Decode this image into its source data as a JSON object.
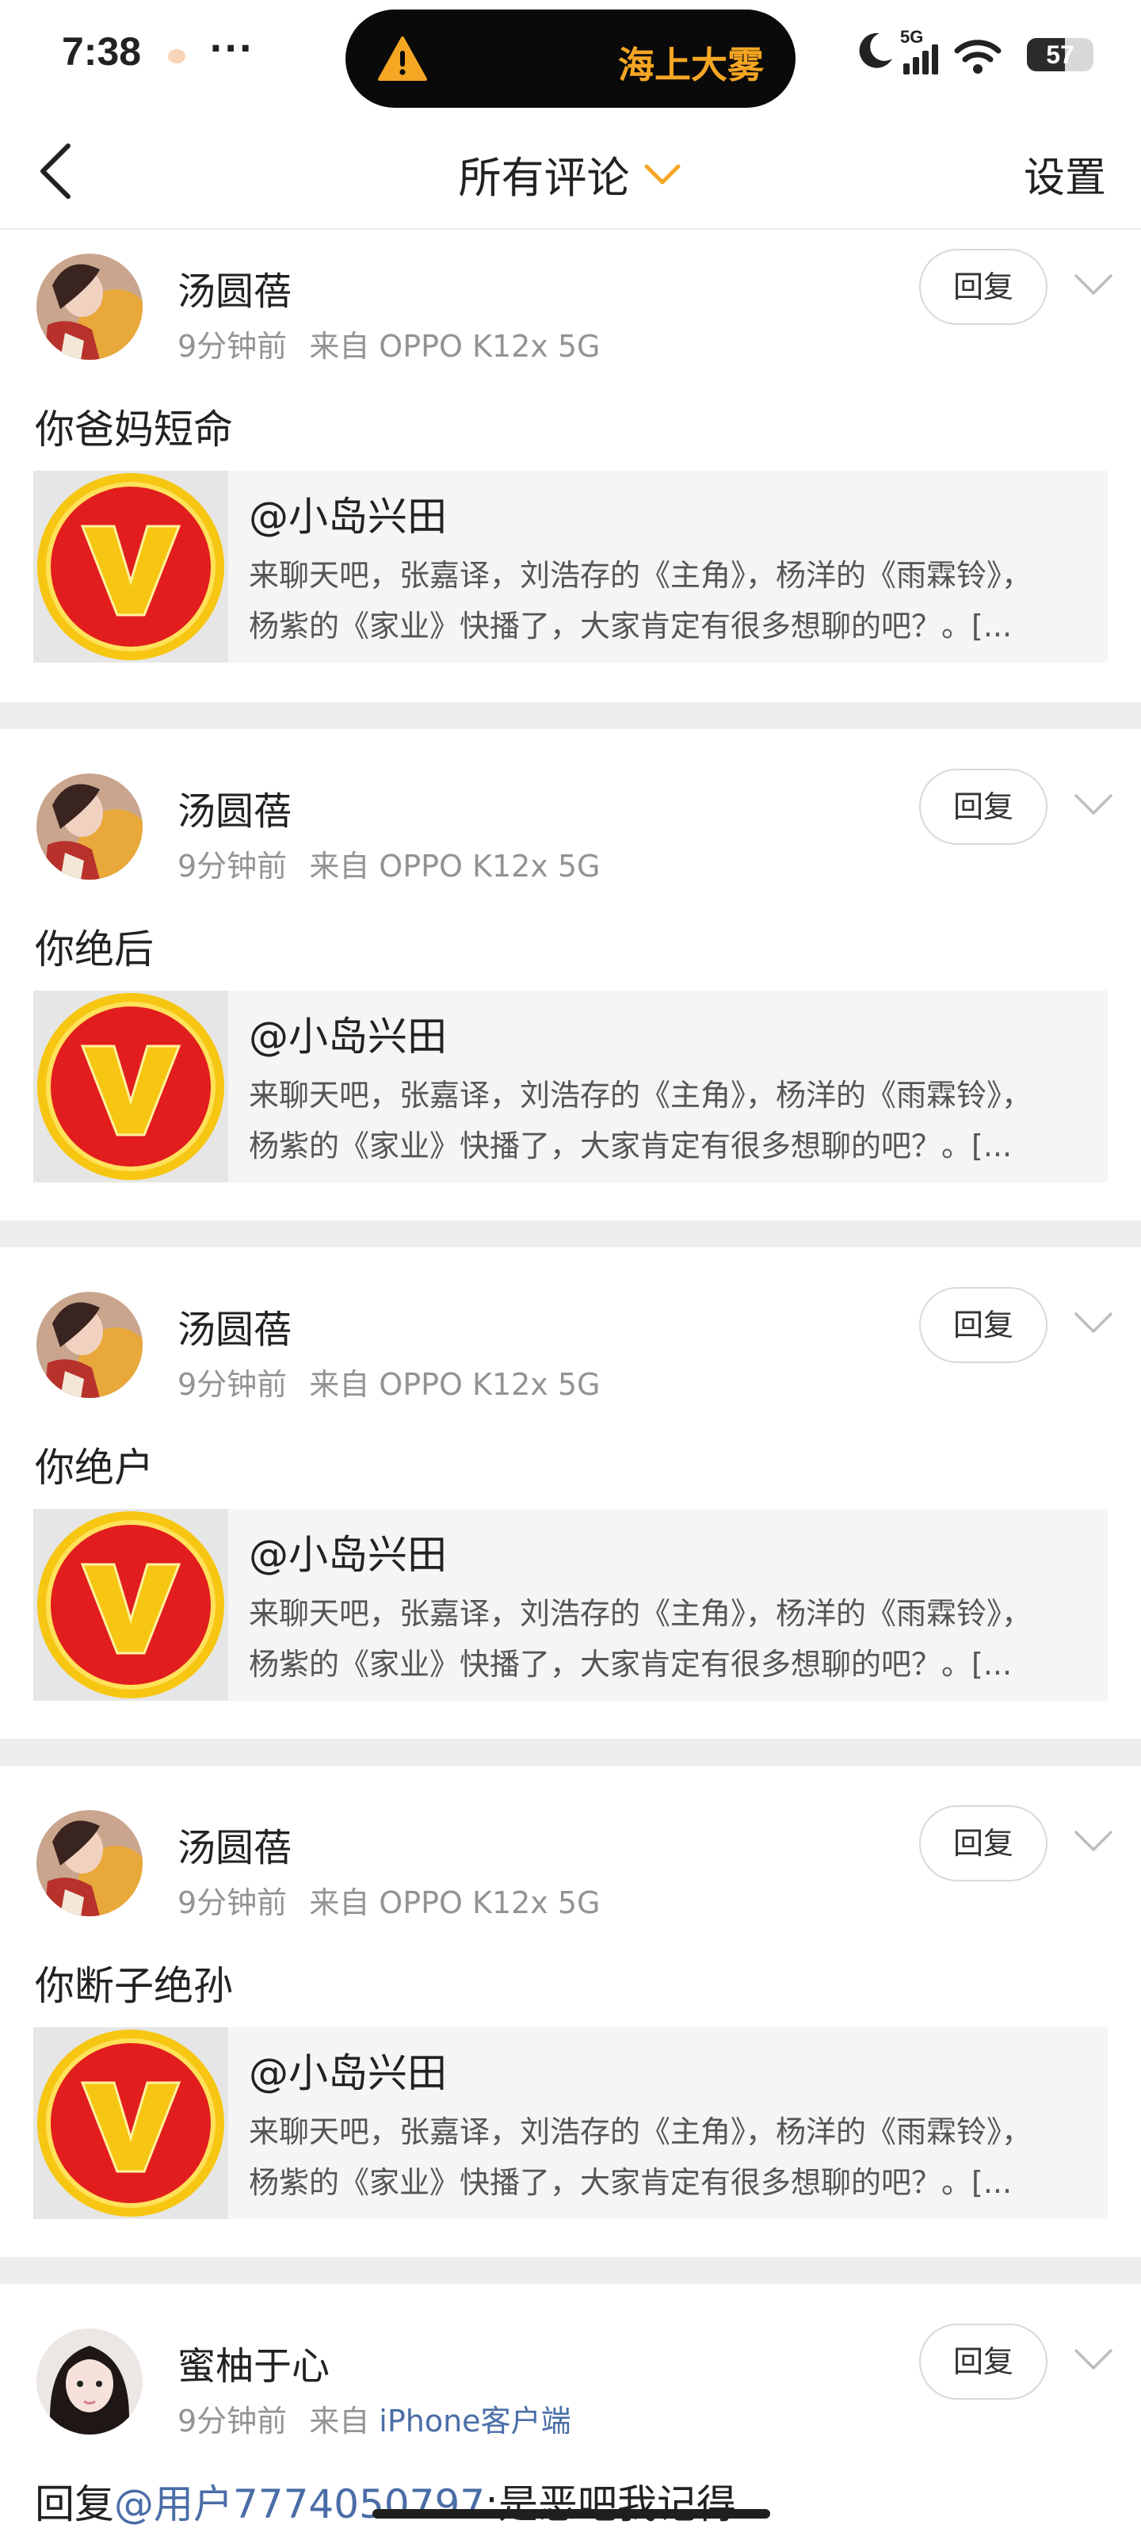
{
  "status_bar": {
    "time": "7:38",
    "more": "···",
    "island_text": "海上大雾",
    "network": "5G",
    "battery": "57",
    "battery_level": 0.57
  },
  "nav": {
    "title": "所有评论",
    "settings": "设置"
  },
  "colors": {
    "accent_orange": "#f5a623",
    "link_blue": "#4a6da7",
    "vip_red": "#e21d1d",
    "vip_gold": "#f6c612"
  },
  "comments": [
    {
      "username": "汤圆蓓",
      "time": "9分钟前",
      "from_label": "来自",
      "source": "OPPO K12x 5G",
      "reply_label": "回复",
      "text": "你爸妈短命",
      "quote": {
        "name": "@小岛兴田",
        "line1": "来聊天吧，张嘉译，刘浩存的《主角》，杨洋的《雨霖铃》，",
        "line2": "杨紫的《家业》快播了，大家肯定有很多想聊的吧？。[..."
      }
    },
    {
      "username": "汤圆蓓",
      "time": "9分钟前",
      "from_label": "来自",
      "source": "OPPO K12x 5G",
      "reply_label": "回复",
      "text": "你绝后",
      "quote": {
        "name": "@小岛兴田",
        "line1": "来聊天吧，张嘉译，刘浩存的《主角》，杨洋的《雨霖铃》，",
        "line2": "杨紫的《家业》快播了，大家肯定有很多想聊的吧？。[..."
      }
    },
    {
      "username": "汤圆蓓",
      "time": "9分钟前",
      "from_label": "来自",
      "source": "OPPO K12x 5G",
      "reply_label": "回复",
      "text": "你绝户",
      "quote": {
        "name": "@小岛兴田",
        "line1": "来聊天吧，张嘉译，刘浩存的《主角》，杨洋的《雨霖铃》，",
        "line2": "杨紫的《家业》快播了，大家肯定有很多想聊的吧？。[..."
      }
    },
    {
      "username": "汤圆蓓",
      "time": "9分钟前",
      "from_label": "来自",
      "source": "OPPO K12x 5G",
      "reply_label": "回复",
      "text": "你断子绝孙",
      "quote": {
        "name": "@小岛兴田",
        "line1": "来聊天吧，张嘉译，刘浩存的《主角》，杨洋的《雨霖铃》，",
        "line2": "杨紫的《家业》快播了，大家肯定有很多想聊的吧？。[..."
      }
    },
    {
      "username": "蜜柚于心",
      "time": "9分钟前",
      "from_label": "来自",
      "source": "iPhone客户端",
      "reply_label": "回复",
      "text_prefix": "回复",
      "text_mention": "@用户7774050797",
      "text_rest": ":是恶吧我记得"
    }
  ]
}
